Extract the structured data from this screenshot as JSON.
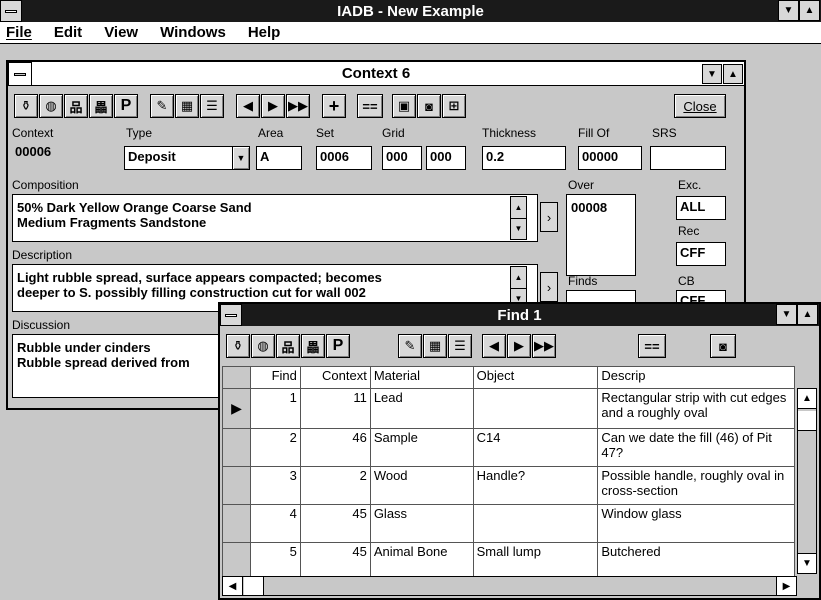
{
  "app": {
    "title": "IADB - New Example"
  },
  "menu": [
    "File",
    "Edit",
    "View",
    "Windows",
    "Help"
  ],
  "context_window": {
    "title": "Context 6",
    "close_label": "Close",
    "toolbar": {
      "p_label": "P",
      "eq_label": "==",
      "plus_label": "+"
    },
    "labels": {
      "context": "Context",
      "type": "Type",
      "area": "Area",
      "set": "Set",
      "grid": "Grid",
      "thickness": "Thickness",
      "fill_of": "Fill Of",
      "srs": "SRS",
      "composition": "Composition",
      "over": "Over",
      "exc": "Exc.",
      "rec": "Rec",
      "description": "Description",
      "finds": "Finds",
      "cb": "CB",
      "discussion": "Discussion"
    },
    "values": {
      "context": "00006",
      "type": "Deposit",
      "area": "A",
      "set": "0006",
      "grid_1": "000",
      "grid_2": "000",
      "thickness": "0.2",
      "fill_of": "00000",
      "srs": "",
      "composition_1": "50% Dark Yellow Orange Coarse Sand",
      "composition_2": "Medium Fragments Sandstone",
      "over": "00008",
      "exc": "ALL",
      "rec": "CFF",
      "cb": "CFF",
      "description_1": "Light rubble spread, surface appears compacted; becomes",
      "description_2": "deeper to S. possibly filling construction cut for wall 002",
      "discussion_1": "Rubble under cinders",
      "discussion_2": "Rubble spread derived from"
    }
  },
  "find_window": {
    "title": "Find 1",
    "toolbar": {
      "p_label": "P",
      "eq_label": "=="
    },
    "columns": [
      "Find",
      "Context",
      "Material",
      "Object",
      "Descrip"
    ],
    "rows": [
      {
        "find": "1",
        "context": "11",
        "material": "Lead",
        "object": "",
        "descrip": "Rectangular strip with cut edges and a roughly oval"
      },
      {
        "find": "2",
        "context": "46",
        "material": "Sample",
        "object": "C14",
        "descrip": "Can we date the fill (46) of Pit 47?"
      },
      {
        "find": "3",
        "context": "2",
        "material": "Wood",
        "object": "Handle?",
        "descrip": "Possible handle, roughly oval in cross-section"
      },
      {
        "find": "4",
        "context": "45",
        "material": "Glass",
        "object": "",
        "descrip": "Window glass"
      },
      {
        "find": "5",
        "context": "45",
        "material": "Animal Bone",
        "object": "Small lump",
        "descrip": "Butchered"
      }
    ]
  }
}
